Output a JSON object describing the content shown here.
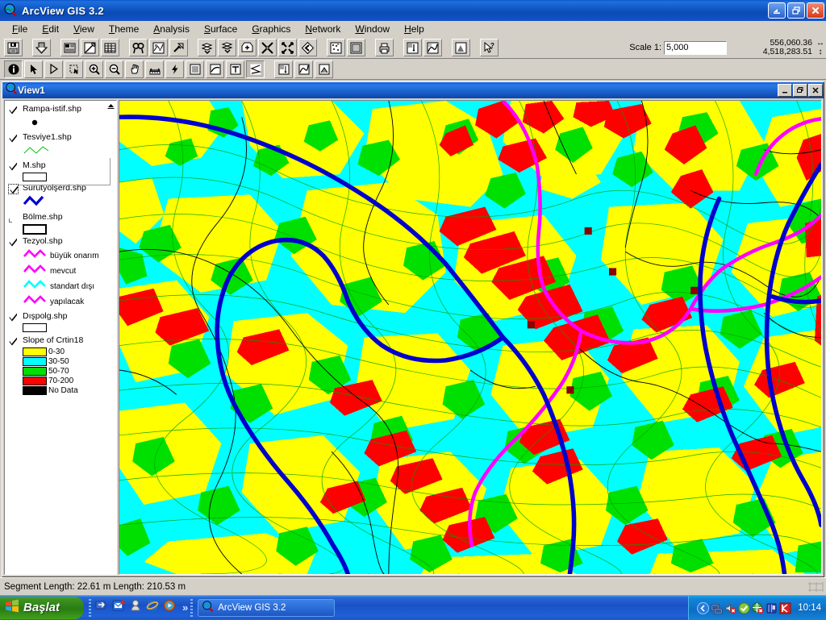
{
  "window": {
    "title": "ArcView GIS 3.2",
    "icon": "arcview-icon",
    "minimize_label": "_",
    "restore_label": "❐",
    "close_label": "✕"
  },
  "menu": [
    {
      "label": "File",
      "accel": "F"
    },
    {
      "label": "Edit",
      "accel": "E"
    },
    {
      "label": "View",
      "accel": "V"
    },
    {
      "label": "Theme",
      "accel": "T"
    },
    {
      "label": "Analysis",
      "accel": "A"
    },
    {
      "label": "Surface",
      "accel": "S"
    },
    {
      "label": "Graphics",
      "accel": "G"
    },
    {
      "label": "Network",
      "accel": "N"
    },
    {
      "label": "Window",
      "accel": "W"
    },
    {
      "label": "Help",
      "accel": "H"
    }
  ],
  "toolbar_main": {
    "groups": [
      [
        "save-project-icon"
      ],
      [
        "add-theme-icon"
      ],
      [
        "theme-properties-icon",
        "edit-legend-icon",
        "open-table-icon"
      ],
      [
        "find-icon",
        "query-builder-icon",
        "select-features-by-theme-icon"
      ],
      [
        "zoom-to-selected-icon",
        "clear-selected-icon",
        "zoom-to-theme-icon",
        "zoom-in-fixed-icon",
        "zoom-out-fixed-icon",
        "zoom-previous-icon"
      ],
      [
        "scatter-icon",
        "layout-icon"
      ],
      [
        "print-icon"
      ],
      [
        "chart-tool-icon",
        "interpolate-icon"
      ],
      [
        "hot-link-icon"
      ],
      [
        "help-pointer-icon"
      ]
    ]
  },
  "toolbar_tools": {
    "groups": [
      [
        "identify-icon",
        "pointer-icon",
        "vertex-edit-icon",
        "select-feature-icon",
        "zoom-in-icon",
        "zoom-out-icon",
        "pan-icon",
        "measure-icon",
        "hotlink-lightning-icon",
        "draw-point-icon",
        "draw-line-icon",
        "label-text-icon",
        "draw-polyline-icon"
      ],
      [
        "histogram-icon",
        "profile-icon",
        "flowpath-icon"
      ]
    ],
    "active_tool": "draw-polyline-icon"
  },
  "scale": {
    "label": "Scale 1:",
    "value": "5,000"
  },
  "coordinates": {
    "x": "556,060.36",
    "y": "4,518,283.51",
    "x_arrow": "↔",
    "y_arrow": "↕"
  },
  "view": {
    "title": "View1",
    "icon": "view-globe-icon",
    "minimize_label": "_",
    "restore_label": "❐",
    "close_label": "✕",
    "scroll_up_icon": "scroll-up-arrow-icon"
  },
  "legend": {
    "themes": [
      {
        "name": "Rampa-istif.shp",
        "checked": true,
        "selected": false,
        "symbol_type": "point",
        "symbols": [
          {
            "label": "",
            "color": "#000000",
            "kind": "dot"
          }
        ]
      },
      {
        "name": "Tesviye1.shp",
        "checked": true,
        "selected": false,
        "symbol_type": "line",
        "symbols": [
          {
            "label": "",
            "color": "#00c000",
            "kind": "zigzag-thin"
          }
        ]
      },
      {
        "name": "M.shp",
        "checked": true,
        "selected": false,
        "symbol_type": "polygon",
        "symbols": [
          {
            "label": "",
            "color": "#ffffff",
            "kind": "rect"
          }
        ]
      },
      {
        "name": "Sürütyolşerd.shp",
        "checked": true,
        "selected": true,
        "symbol_type": "line",
        "symbols": [
          {
            "label": "",
            "color": "#0000d0",
            "kind": "zigzag-thick"
          }
        ]
      },
      {
        "name": "Bölme.shp",
        "checked": false,
        "selected": false,
        "symbol_type": "polygon",
        "symbols": [
          {
            "label": "",
            "color": "#ffffff",
            "kind": "rect-bold"
          }
        ]
      },
      {
        "name": "Tezyol.shp",
        "checked": true,
        "selected": false,
        "symbol_type": "line",
        "symbols": [
          {
            "label": "büyük onarım",
            "color": "#ff00ff",
            "kind": "zigzag"
          },
          {
            "label": "mevcut",
            "color": "#ff00ff",
            "kind": "zigzag"
          },
          {
            "label": "standart dışı",
            "color": "#00ffff",
            "kind": "zigzag"
          },
          {
            "label": "yapılacak",
            "color": "#ff00ff",
            "kind": "zigzag"
          }
        ]
      },
      {
        "name": "Dışpolg.shp",
        "checked": true,
        "selected": false,
        "symbol_type": "polygon",
        "symbols": [
          {
            "label": "",
            "color": "#ffffff",
            "kind": "rect"
          }
        ]
      },
      {
        "name": "Slope of Crtin18",
        "checked": true,
        "selected": false,
        "symbol_type": "classified",
        "symbols": [
          {
            "label": "0-30",
            "color": "#ffff00",
            "kind": "fill"
          },
          {
            "label": "30-50",
            "color": "#00ffff",
            "kind": "fill"
          },
          {
            "label": "50-70",
            "color": "#00e000",
            "kind": "fill"
          },
          {
            "label": "70-200",
            "color": "#ff0000",
            "kind": "fill"
          },
          {
            "label": "No Data",
            "color": "#000000",
            "kind": "fill"
          }
        ]
      }
    ]
  },
  "map": {
    "colors": {
      "class_0_30": "#ffff00",
      "class_30_50": "#00ffff",
      "class_50_70": "#00e000",
      "class_70_200": "#ff0000",
      "no_data": "#000000",
      "skid_road": "#0000cd",
      "forest_road": "#ff00ff",
      "contour": "#00c000",
      "boundary": "#000000"
    }
  },
  "statusbar": {
    "text": "Segment Length: 22.61 m  Length: 210.53 m",
    "resize_grip": "resize-grip-icon"
  },
  "taskbar": {
    "start_label": "Başlat",
    "start_icon": "windows-flag-icon",
    "quick_launch": [
      {
        "name": "show-desktop-icon"
      },
      {
        "name": "outlook-express-icon"
      },
      {
        "name": "windows-media-icon"
      },
      {
        "name": "internet-explorer-icon"
      },
      {
        "name": "media-player-icon"
      }
    ],
    "overflow_label": "»",
    "tasks": [
      {
        "label": "ArcView GIS 3.2",
        "icon": "arcview-icon",
        "active": true
      }
    ],
    "tray_icons": [
      {
        "name": "tray-expand-icon"
      },
      {
        "name": "network-icon"
      },
      {
        "name": "volume-muted-icon"
      },
      {
        "name": "shield-ok-icon"
      },
      {
        "name": "network-error-icon"
      },
      {
        "name": "book-icon"
      },
      {
        "name": "kaspersky-icon"
      }
    ],
    "clock": "10:14"
  }
}
